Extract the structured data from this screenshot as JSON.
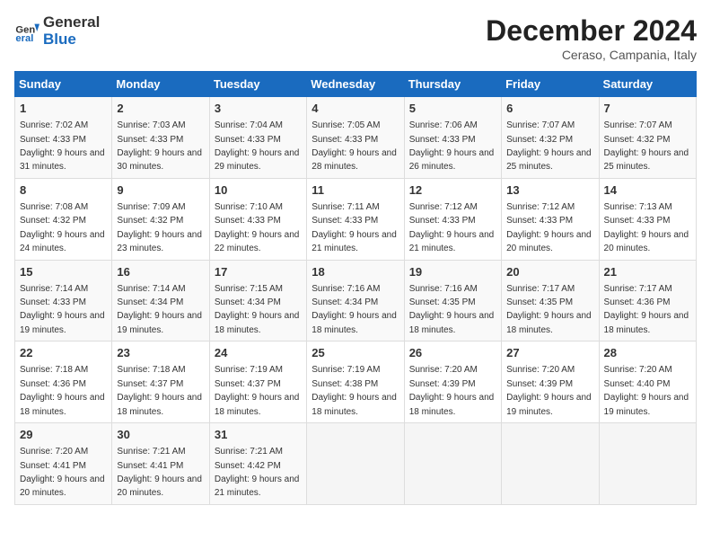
{
  "logo": {
    "line1": "General",
    "line2": "Blue"
  },
  "title": "December 2024",
  "subtitle": "Ceraso, Campania, Italy",
  "days_of_week": [
    "Sunday",
    "Monday",
    "Tuesday",
    "Wednesday",
    "Thursday",
    "Friday",
    "Saturday"
  ],
  "weeks": [
    [
      {
        "day": "1",
        "sunrise": "7:02 AM",
        "sunset": "4:33 PM",
        "daylight": "9 hours and 31 minutes."
      },
      {
        "day": "2",
        "sunrise": "7:03 AM",
        "sunset": "4:33 PM",
        "daylight": "9 hours and 30 minutes."
      },
      {
        "day": "3",
        "sunrise": "7:04 AM",
        "sunset": "4:33 PM",
        "daylight": "9 hours and 29 minutes."
      },
      {
        "day": "4",
        "sunrise": "7:05 AM",
        "sunset": "4:33 PM",
        "daylight": "9 hours and 28 minutes."
      },
      {
        "day": "5",
        "sunrise": "7:06 AM",
        "sunset": "4:33 PM",
        "daylight": "9 hours and 26 minutes."
      },
      {
        "day": "6",
        "sunrise": "7:07 AM",
        "sunset": "4:32 PM",
        "daylight": "9 hours and 25 minutes."
      },
      {
        "day": "7",
        "sunrise": "7:07 AM",
        "sunset": "4:32 PM",
        "daylight": "9 hours and 25 minutes."
      }
    ],
    [
      {
        "day": "8",
        "sunrise": "7:08 AM",
        "sunset": "4:32 PM",
        "daylight": "9 hours and 24 minutes."
      },
      {
        "day": "9",
        "sunrise": "7:09 AM",
        "sunset": "4:32 PM",
        "daylight": "9 hours and 23 minutes."
      },
      {
        "day": "10",
        "sunrise": "7:10 AM",
        "sunset": "4:33 PM",
        "daylight": "9 hours and 22 minutes."
      },
      {
        "day": "11",
        "sunrise": "7:11 AM",
        "sunset": "4:33 PM",
        "daylight": "9 hours and 21 minutes."
      },
      {
        "day": "12",
        "sunrise": "7:12 AM",
        "sunset": "4:33 PM",
        "daylight": "9 hours and 21 minutes."
      },
      {
        "day": "13",
        "sunrise": "7:12 AM",
        "sunset": "4:33 PM",
        "daylight": "9 hours and 20 minutes."
      },
      {
        "day": "14",
        "sunrise": "7:13 AM",
        "sunset": "4:33 PM",
        "daylight": "9 hours and 20 minutes."
      }
    ],
    [
      {
        "day": "15",
        "sunrise": "7:14 AM",
        "sunset": "4:33 PM",
        "daylight": "9 hours and 19 minutes."
      },
      {
        "day": "16",
        "sunrise": "7:14 AM",
        "sunset": "4:34 PM",
        "daylight": "9 hours and 19 minutes."
      },
      {
        "day": "17",
        "sunrise": "7:15 AM",
        "sunset": "4:34 PM",
        "daylight": "9 hours and 18 minutes."
      },
      {
        "day": "18",
        "sunrise": "7:16 AM",
        "sunset": "4:34 PM",
        "daylight": "9 hours and 18 minutes."
      },
      {
        "day": "19",
        "sunrise": "7:16 AM",
        "sunset": "4:35 PM",
        "daylight": "9 hours and 18 minutes."
      },
      {
        "day": "20",
        "sunrise": "7:17 AM",
        "sunset": "4:35 PM",
        "daylight": "9 hours and 18 minutes."
      },
      {
        "day": "21",
        "sunrise": "7:17 AM",
        "sunset": "4:36 PM",
        "daylight": "9 hours and 18 minutes."
      }
    ],
    [
      {
        "day": "22",
        "sunrise": "7:18 AM",
        "sunset": "4:36 PM",
        "daylight": "9 hours and 18 minutes."
      },
      {
        "day": "23",
        "sunrise": "7:18 AM",
        "sunset": "4:37 PM",
        "daylight": "9 hours and 18 minutes."
      },
      {
        "day": "24",
        "sunrise": "7:19 AM",
        "sunset": "4:37 PM",
        "daylight": "9 hours and 18 minutes."
      },
      {
        "day": "25",
        "sunrise": "7:19 AM",
        "sunset": "4:38 PM",
        "daylight": "9 hours and 18 minutes."
      },
      {
        "day": "26",
        "sunrise": "7:20 AM",
        "sunset": "4:39 PM",
        "daylight": "9 hours and 18 minutes."
      },
      {
        "day": "27",
        "sunrise": "7:20 AM",
        "sunset": "4:39 PM",
        "daylight": "9 hours and 19 minutes."
      },
      {
        "day": "28",
        "sunrise": "7:20 AM",
        "sunset": "4:40 PM",
        "daylight": "9 hours and 19 minutes."
      }
    ],
    [
      {
        "day": "29",
        "sunrise": "7:20 AM",
        "sunset": "4:41 PM",
        "daylight": "9 hours and 20 minutes."
      },
      {
        "day": "30",
        "sunrise": "7:21 AM",
        "sunset": "4:41 PM",
        "daylight": "9 hours and 20 minutes."
      },
      {
        "day": "31",
        "sunrise": "7:21 AM",
        "sunset": "4:42 PM",
        "daylight": "9 hours and 21 minutes."
      },
      null,
      null,
      null,
      null
    ]
  ],
  "labels": {
    "sunrise": "Sunrise:",
    "sunset": "Sunset:",
    "daylight": "Daylight:"
  }
}
